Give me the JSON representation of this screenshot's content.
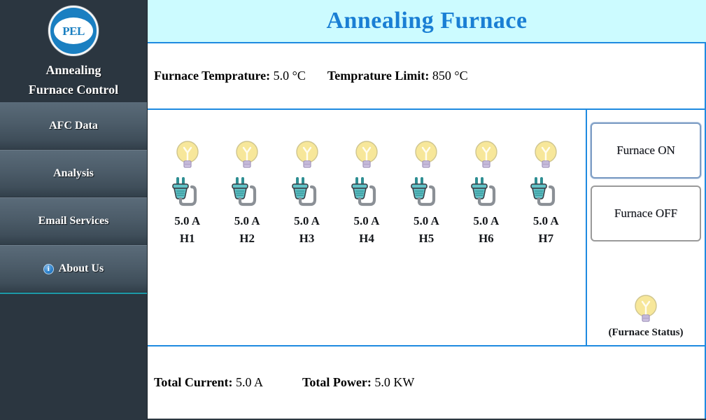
{
  "sidebar": {
    "logo": {
      "text": "PEL",
      "icon": "pel-logo-icon",
      "color": "#1a7fc1"
    },
    "brand_line1": "Annealing",
    "brand_line2": "Furnace Control",
    "items": [
      {
        "label": "AFC Data",
        "icon": null
      },
      {
        "label": "Analysis",
        "icon": null
      },
      {
        "label": "Email Services",
        "icon": null
      },
      {
        "label": "About Us",
        "icon": "info-icon",
        "icon_glyph": "i"
      }
    ]
  },
  "header": {
    "title": "Annealing Furnace",
    "title_color": "#1a7fd4",
    "background": "#ccfbff"
  },
  "temperature": {
    "furnace_label": "Furnace Temprature:",
    "furnace_value": "5.0 °C",
    "limit_label": "Temprature Limit:",
    "limit_value": "850 °C"
  },
  "heaters": [
    {
      "name": "H1",
      "current": "5.0 A",
      "bulb": "bulb-on-icon",
      "plug": "plug-icon"
    },
    {
      "name": "H2",
      "current": "5.0 A",
      "bulb": "bulb-on-icon",
      "plug": "plug-icon"
    },
    {
      "name": "H3",
      "current": "5.0 A",
      "bulb": "bulb-on-icon",
      "plug": "plug-icon"
    },
    {
      "name": "H4",
      "current": "5.0 A",
      "bulb": "bulb-on-icon",
      "plug": "plug-icon"
    },
    {
      "name": "H5",
      "current": "5.0 A",
      "bulb": "bulb-on-icon",
      "plug": "plug-icon"
    },
    {
      "name": "H6",
      "current": "5.0 A",
      "bulb": "bulb-on-icon",
      "plug": "plug-icon"
    },
    {
      "name": "H7",
      "current": "5.0 A",
      "bulb": "bulb-on-icon",
      "plug": "plug-icon"
    }
  ],
  "controls": {
    "on_label": "Furnace ON",
    "off_label": "Furnace OFF",
    "status_caption": "(Furnace Status)",
    "status_icon": "bulb-on-icon"
  },
  "totals": {
    "current_label": "Total Current:",
    "current_value": "5.0 A",
    "power_label": "Total Power:",
    "power_value": "5.0 KW"
  },
  "colors": {
    "sidebar_bg": "#2b3640",
    "accent_blue": "#1e8ae0",
    "panel_bg": "#ffffff",
    "separator_teal": "#1d9aa8",
    "bulb_yellow": "#f7e79a",
    "plug_teal": "#63c3c8"
  }
}
